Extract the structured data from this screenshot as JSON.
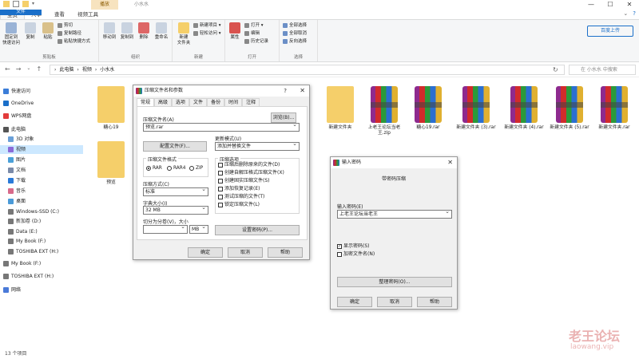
{
  "titlebar": {
    "context_tab": "播放",
    "window_title": "小水水",
    "controls": [
      "—",
      "☐",
      "✕"
    ]
  },
  "tabs": {
    "items": [
      "文件",
      "主页",
      "共享",
      "查看",
      "视频工具"
    ],
    "help": "?",
    "expand": "⌄"
  },
  "ribbon": {
    "clipboard": {
      "label": "剪贴板",
      "pin": "固定到\n快速访问",
      "copy": "复制",
      "paste": "粘贴",
      "cut": "剪切",
      "copy_path": "复制路径",
      "paste_shortcut": "粘贴快捷方式"
    },
    "organize": {
      "label": "组织",
      "move_to": "移动到",
      "copy_to": "复制到",
      "delete": "删除",
      "rename": "重命名"
    },
    "new": {
      "label": "新建",
      "new_folder": "新建\n文件夹",
      "new_item": "新建项目 ▾",
      "easy_access": "轻松访问 ▾"
    },
    "open": {
      "label": "打开",
      "properties": "属性",
      "open": "打开 ▾",
      "edit": "编辑",
      "history": "历史记录"
    },
    "select": {
      "label": "选择",
      "select_all": "全部选择",
      "select_none": "全部取消",
      "invert": "反向选择"
    },
    "upload": "百度上传"
  },
  "address": {
    "crumbs": [
      "此电脑",
      "视频",
      "小水水"
    ],
    "search_placeholder": "在 小水水 中搜索"
  },
  "sidebar": {
    "items": [
      "快速访问",
      "OneDrive",
      "WPS网盘",
      "此电脑",
      "3D 对象",
      "视频",
      "图片",
      "文档",
      "下载",
      "音乐",
      "桌面",
      "Windows-SSD (C:)",
      "新加卷 (D:)",
      "Data (E:)",
      "My Book (F:)",
      "TOSHIBA EXT (H:)",
      "My Book (F:)",
      "TOSHIBA EXT (H:)",
      "网络"
    ]
  },
  "files": [
    {
      "name": "糖心19",
      "kind": "folder"
    },
    {
      "name": "新建文件夹",
      "kind": "folder"
    },
    {
      "name": "上老王论坛当老王.zip",
      "kind": "rar"
    },
    {
      "name": "糖心19.rar",
      "kind": "rar"
    },
    {
      "name": "新建文件夹 (3).rar",
      "kind": "rar"
    },
    {
      "name": "新建文件夹 (4).rar",
      "kind": "rar"
    },
    {
      "name": "新建文件夹 (5).rar",
      "kind": "rar"
    },
    {
      "name": "新建文件夹.rar",
      "kind": "rar"
    },
    {
      "name": "预览",
      "kind": "folder"
    }
  ],
  "status": "13 个项目",
  "watermark": {
    "cn": "老王论坛",
    "en": "laowang.vip"
  },
  "archive_dialog": {
    "title": "压缩文件名和参数",
    "help": "?",
    "tabs": [
      "常规",
      "高级",
      "选项",
      "文件",
      "备份",
      "时间",
      "注释"
    ],
    "name_label": "压缩文件名(A)",
    "name_value": "预览.rar",
    "browse": "浏览(B)...",
    "profile": "配置文件(F)...",
    "update_label": "更新模式(U)",
    "update_value": "添加并替换文件",
    "format_label": "压缩文件格式",
    "formats": [
      "RAR",
      "RAR4",
      "ZIP"
    ],
    "method_label": "压缩方式(C)",
    "method_value": "标准",
    "dict_label": "字典大小(I)",
    "dict_value": "32 MB",
    "split_label": "切分为分卷(V)，大小",
    "split_unit": "MB",
    "options_label": "压缩选项",
    "options": [
      "压缩后删除原来的文件(D)",
      "创建自解压格式压缩文件(X)",
      "创建固实压缩文件(S)",
      "添加恢复记录(E)",
      "测试压缩的文件(T)",
      "锁定压缩文件(L)"
    ],
    "set_password": "设置密码(P)...",
    "ok": "确定",
    "cancel": "取消",
    "help_btn": "帮助"
  },
  "password_dialog": {
    "title": "输入密码",
    "subtitle": "带密码压缩",
    "input_label": "输入密码(E)",
    "input_value": "上老王论坛当老王",
    "show_password": "显示密码(S)",
    "encrypt_names": "加密文件名(N)",
    "organize": "整理密码(O)...",
    "ok": "确定",
    "cancel": "取消",
    "help_btn": "帮助"
  }
}
